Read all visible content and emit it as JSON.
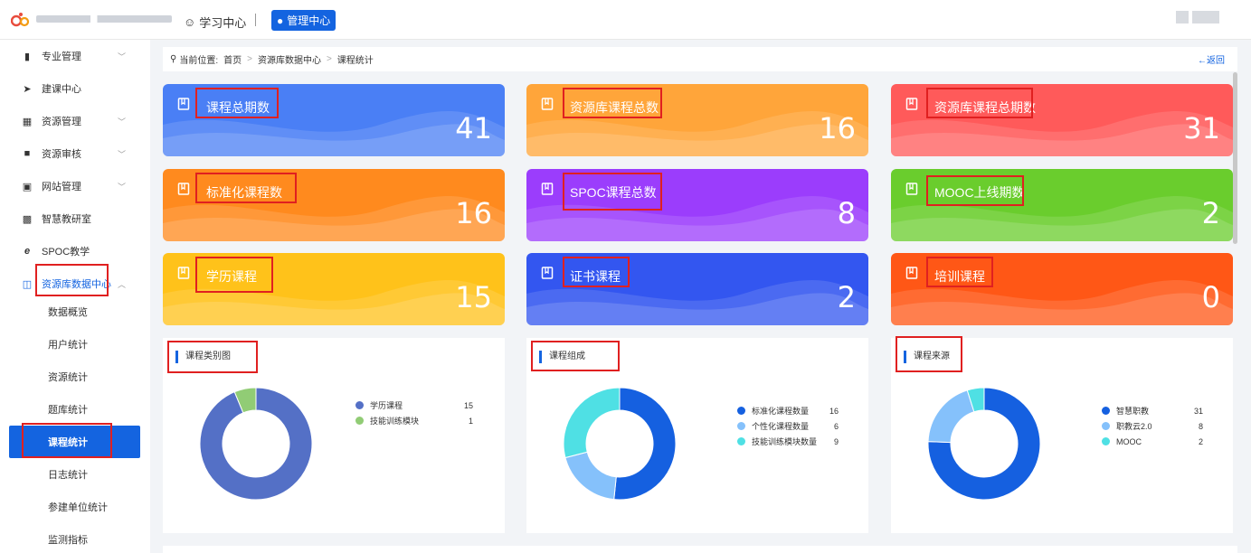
{
  "topbar": {
    "study_center": "学习中心",
    "manage_center": "管理中心"
  },
  "sidebar": {
    "items": [
      {
        "label": "专业管理",
        "icon": "book-icon",
        "arrow": "﹀"
      },
      {
        "label": "建课中心",
        "icon": "send-icon",
        "arrow": ""
      },
      {
        "label": "资源管理",
        "icon": "folder-icon",
        "arrow": "﹀"
      },
      {
        "label": "资源审核",
        "icon": "review-icon",
        "arrow": "﹀"
      },
      {
        "label": "网站管理",
        "icon": "monitor-icon",
        "arrow": "﹀"
      },
      {
        "label": "智慧教研室",
        "icon": "file-icon",
        "arrow": ""
      },
      {
        "label": "SPOC教学",
        "icon": "ie-icon",
        "arrow": ""
      },
      {
        "label": "资源库数据中心",
        "icon": "chart-icon",
        "arrow": "︿"
      }
    ],
    "subitems": [
      {
        "label": "数据概览"
      },
      {
        "label": "用户统计"
      },
      {
        "label": "资源统计"
      },
      {
        "label": "题库统计"
      },
      {
        "label": "课程统计"
      },
      {
        "label": "日志统计"
      },
      {
        "label": "参建单位统计"
      },
      {
        "label": "监测指标"
      }
    ]
  },
  "breadcrumb": {
    "prefix": "当前位置:",
    "items": [
      "首页",
      "资源库数据中心",
      "课程统计"
    ],
    "back": "←返回"
  },
  "cards": [
    {
      "title": "课程总期数",
      "value": "41",
      "color": "#4a7ff5"
    },
    {
      "title": "资源库课程总数",
      "value": "16",
      "color": "#ffa53a"
    },
    {
      "title": "资源库课程总期数",
      "value": "31",
      "color": "#ff5a5a"
    },
    {
      "title": "标准化课程数",
      "value": "16",
      "color": "#ff8a1e"
    },
    {
      "title": "SPOC课程总数",
      "value": "8",
      "color": "#9b3dfc"
    },
    {
      "title": "MOOC上线期数",
      "value": "2",
      "color": "#6acd2d"
    },
    {
      "title": "学历课程",
      "value": "15",
      "color": "#ffc21a"
    },
    {
      "title": "证书课程",
      "value": "2",
      "color": "#3356f0"
    },
    {
      "title": "培训课程",
      "value": "0",
      "color": "#ff5716"
    }
  ],
  "panels": [
    {
      "title": "课程类别图",
      "legend": [
        {
          "label": "学历课程",
          "value": 15,
          "color": "#5470c6"
        },
        {
          "label": "技能训练模块",
          "value": 1,
          "color": "#91cc75"
        }
      ]
    },
    {
      "title": "课程组成",
      "legend": [
        {
          "label": "标准化课程数量",
          "value": 16,
          "color": "#1560e0"
        },
        {
          "label": "个性化课程数量",
          "value": 6,
          "color": "#85c1fb"
        },
        {
          "label": "技能训练模块数量",
          "value": 9,
          "color": "#4fe0e4"
        }
      ]
    },
    {
      "title": "课程来源",
      "legend": [
        {
          "label": "智慧职教",
          "value": 31,
          "color": "#1560e0"
        },
        {
          "label": "职教云2.0",
          "value": 8,
          "color": "#85c1fb"
        },
        {
          "label": "MOOC",
          "value": 2,
          "color": "#4fe0e4"
        }
      ]
    }
  ]
}
